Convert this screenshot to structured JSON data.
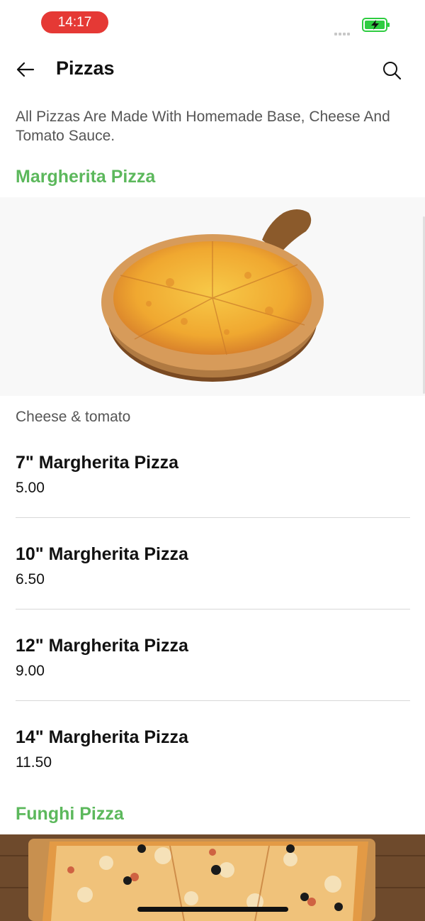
{
  "status_bar": {
    "time": "14:17",
    "colors": {
      "time_pill": "#e53935",
      "battery": "#2ecc40"
    }
  },
  "header": {
    "title": "Pizzas",
    "back_icon": "arrow-left-icon",
    "search_icon": "search-icon"
  },
  "intro_text": "All Pizzas Are Made With Homemade Base, Cheese And Tomato Sauce.",
  "accent_color": "#5cb85c",
  "sections": [
    {
      "title": "Margherita Pizza",
      "image": "margherita-pizza-image",
      "subtitle": "Cheese & tomato",
      "items": [
        {
          "name": "7\" Margherita Pizza",
          "price": "5.00"
        },
        {
          "name": "10\" Margherita Pizza",
          "price": "6.50"
        },
        {
          "name": "12\" Margherita Pizza",
          "price": "9.00"
        },
        {
          "name": "14\" Margherita Pizza",
          "price": "11.50"
        }
      ]
    },
    {
      "title": "Funghi Pizza",
      "image": "funghi-pizza-image"
    }
  ]
}
